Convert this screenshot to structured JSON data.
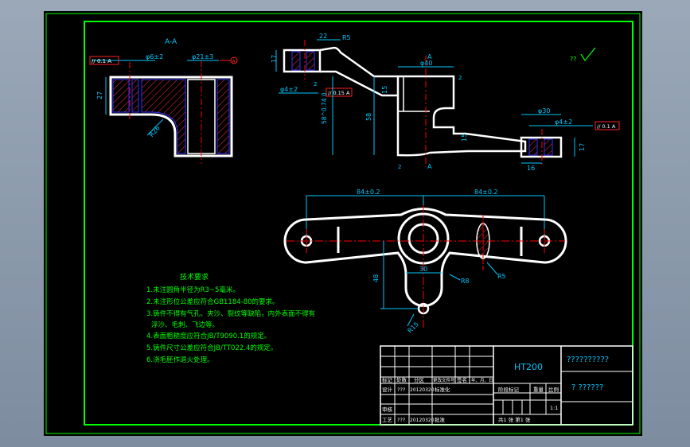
{
  "colors": {
    "background": "#000000",
    "border": "#00ff00",
    "outline": "#ffffff",
    "dimension": "#00c8ff",
    "center": "#ff0000",
    "hatch": "#ff0000",
    "fill_outline": "#0000ff",
    "text_green": "#00ff00",
    "text_white": "#ffffff",
    "text_cyan": "#00c8ff"
  },
  "section_view": {
    "label": "A-A",
    "dims": {
      "parallel_tol": "// 0.1 A",
      "hole_small": "φ6±2",
      "hole_large": "φ21±3",
      "height": "27",
      "radius": "R26"
    }
  },
  "front_view": {
    "dims": {
      "top_width": "22",
      "top_radius": "R5",
      "left_height": "17",
      "left_hole": "φ4±2",
      "parallel_tol": "// 0.15 A",
      "center_dia": "φ40",
      "dim_15": "15",
      "dim_58_074": "58^0.74 0",
      "dim_58": "58",
      "dim_2a": "2",
      "dim_2b": "2",
      "dim_2c": "2",
      "section_mark_top": "A",
      "section_mark_bottom": "A",
      "right_dia": "φ30",
      "right_hole": "φ4±2",
      "right_tol": "// 0.1 A",
      "right_height": "17",
      "right_width": "16",
      "dim_15b": "15"
    }
  },
  "roughness": {
    "label": "??"
  },
  "plan_view": {
    "dims": {
      "left_span": "84±0.2",
      "right_span": "84±0.2",
      "height_48": "48",
      "width_30": "30",
      "r8": "R8",
      "r5": "R5",
      "r15": "R15"
    }
  },
  "tech_req": {
    "title": "技术要求",
    "lines": [
      "1.未注圆角半径为R3~5毫米。",
      "2.未注形位公差应符合GB1184-80的要求。",
      "3.铸件不得有气孔、夹沙、裂纹等缺陷，内外表面不得有",
      "浮沙、毛刺、飞边等。",
      "4.表面粗糙度应符合JB/T9090.1的规定。",
      "5.铸件尺寸公差应符合JB/TT022.4的规定。",
      "6.浇毛胚作退火处理。"
    ]
  },
  "title_block": {
    "material": "HT200",
    "drawing_name": "??????????",
    "part_code": "? ??????",
    "row_headers": [
      "标记",
      "处数",
      "分区",
      "更改文件号",
      "签名",
      "年、月、日"
    ],
    "design_label": "设计",
    "design_name": "???",
    "design_date": "20120320",
    "standard_label": "标准化",
    "stage_label": "阶段标记",
    "weight_label": "重量",
    "scale_label": "比例",
    "scale_value": "1:1",
    "check_label": "审核",
    "process_label": "工艺",
    "process_name": "???",
    "process_date": "20120320",
    "approve_label": "批准",
    "sheets": "共1 张 第1 张"
  }
}
